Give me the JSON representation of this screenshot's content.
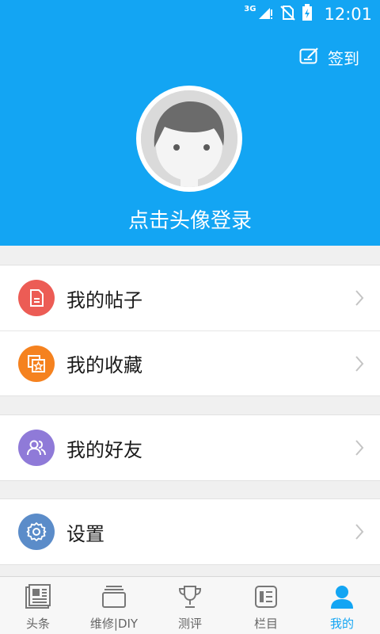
{
  "status_bar": {
    "network": "3G",
    "time": "12:01"
  },
  "header": {
    "checkin_label": "签到",
    "login_prompt": "点击头像登录"
  },
  "menu_groups": [
    {
      "items": [
        {
          "label": "我的帖子",
          "icon": "document-icon",
          "color": "#ec5c55"
        },
        {
          "label": "我的收藏",
          "icon": "favorites-icon",
          "color": "#f5821f"
        }
      ]
    },
    {
      "items": [
        {
          "label": "我的好友",
          "icon": "friends-icon",
          "color": "#8f7ad8"
        }
      ]
    },
    {
      "items": [
        {
          "label": "设置",
          "icon": "gear-icon",
          "color": "#5b8cc9"
        }
      ]
    }
  ],
  "tabs": [
    {
      "label": "头条",
      "icon": "newspaper-icon",
      "active": false
    },
    {
      "label": "维修|DIY",
      "icon": "cards-icon",
      "active": false
    },
    {
      "label": "测评",
      "icon": "trophy-icon",
      "active": false
    },
    {
      "label": "栏目",
      "icon": "column-icon",
      "active": false
    },
    {
      "label": "我的",
      "icon": "user-icon",
      "active": true
    }
  ],
  "colors": {
    "brand": "#13a5f3",
    "inactive_tab": "#666666"
  }
}
